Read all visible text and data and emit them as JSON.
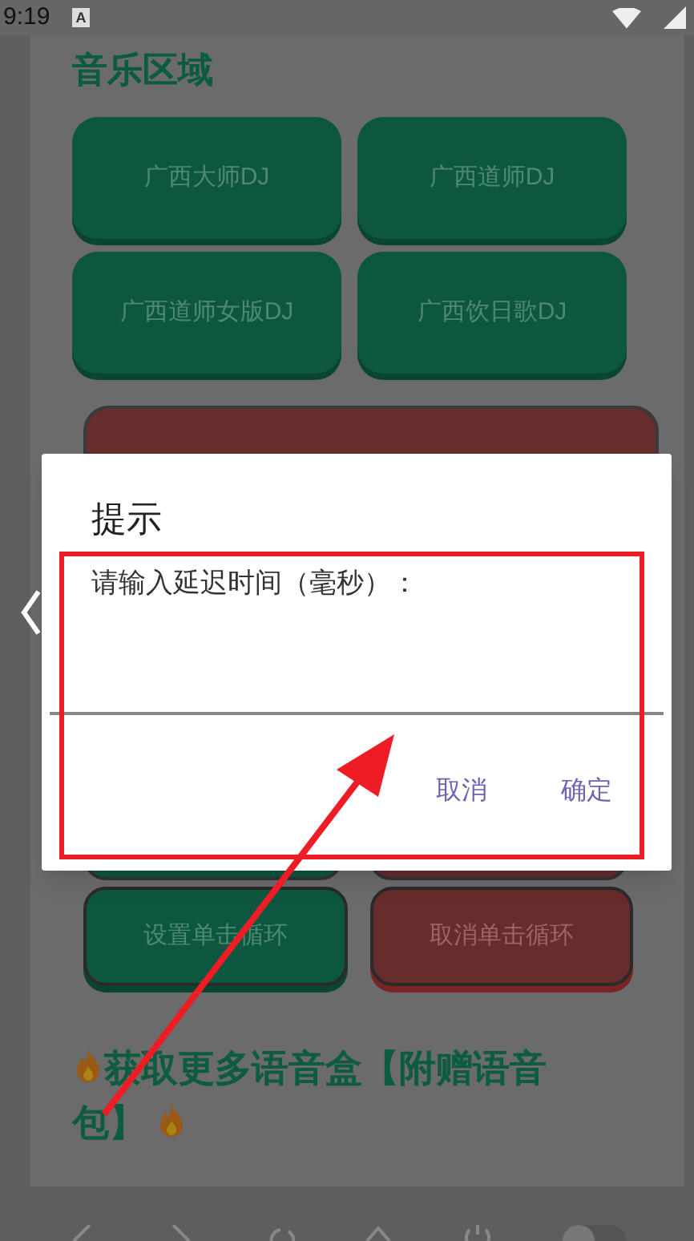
{
  "status_bar": {
    "time": "9:19",
    "notification": "A"
  },
  "music_section": {
    "title": "音乐区域",
    "buttons": [
      {
        "label": "广西大师DJ"
      },
      {
        "label": "广西道师DJ"
      },
      {
        "label": "广西道师女版DJ"
      },
      {
        "label": "广西饮日歌DJ"
      }
    ]
  },
  "loop_buttons": [
    {
      "label": "设置单击循环",
      "kind": "green"
    },
    {
      "label": "取消单击循环",
      "kind": "red"
    }
  ],
  "promo": {
    "text": "获取更多语音盒【附赠语音包】"
  },
  "nav_toggle": {
    "on": false
  },
  "dialog": {
    "title": "提示",
    "message": "请输入延迟时间（毫秒）：",
    "buttons": [
      "取消",
      "确定"
    ]
  }
}
